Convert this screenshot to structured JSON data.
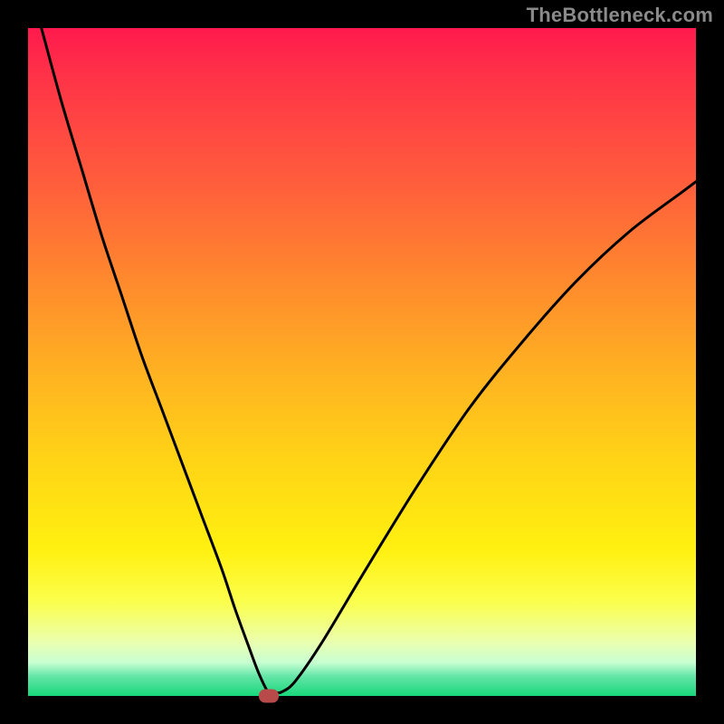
{
  "attribution": "TheBottleneck.com",
  "colors": {
    "frame": "#000000",
    "curve": "#000000",
    "marker": "#b94a4a",
    "gradient_top": "#ff1a4d",
    "gradient_bottom": "#18d77a"
  },
  "chart_data": {
    "type": "line",
    "title": "",
    "xlabel": "",
    "ylabel": "",
    "xlim": [
      0,
      100
    ],
    "ylim": [
      0,
      100
    ],
    "marker": {
      "x": 36,
      "y": 0
    },
    "series": [
      {
        "name": "curve",
        "x": [
          2,
          5,
          8,
          11,
          14,
          17,
          20,
          23,
          26,
          29,
          31,
          33,
          34.5,
          36,
          37,
          38,
          40,
          44,
          50,
          58,
          66,
          74,
          82,
          90,
          98,
          100
        ],
        "y": [
          100,
          89,
          79,
          69,
          60,
          51,
          43,
          35,
          27,
          19,
          13,
          7.5,
          3.5,
          0.5,
          0.5,
          0.6,
          2.2,
          8,
          18,
          31,
          43,
          53,
          62,
          69.5,
          75.5,
          77
        ]
      }
    ]
  }
}
